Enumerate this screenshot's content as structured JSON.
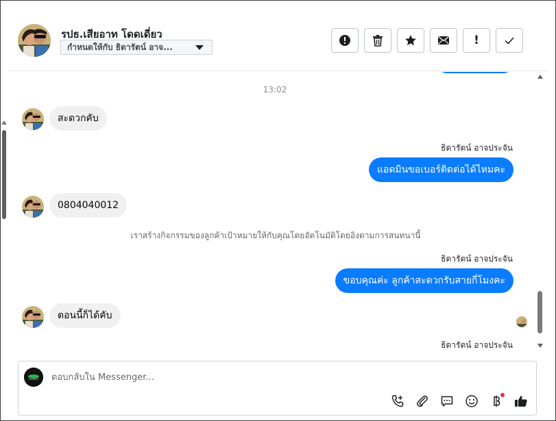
{
  "header": {
    "contact_name": "รปธ.เสียอาท โดดเดี่ยว",
    "assign_label": "กำหนดให้กับ ธิดารัตน์ อาจ...",
    "actions": [
      {
        "name": "spam-button",
        "icon": "alert-circle-icon"
      },
      {
        "name": "delete-button",
        "icon": "trash-icon"
      },
      {
        "name": "star-button",
        "icon": "star-icon"
      },
      {
        "name": "mark-unread-button",
        "icon": "envelope-icon"
      },
      {
        "name": "follow-up-button",
        "icon": "exclamation-icon"
      },
      {
        "name": "mark-done-button",
        "icon": "checkmark-icon"
      }
    ]
  },
  "conversation": {
    "timestamp": "13:02",
    "messages": [
      {
        "direction": "in",
        "text": "สะดวกคับ"
      },
      {
        "direction": "out",
        "sender": "ธิดารัตน์ อาจประจัน",
        "text": "แอดมินขอเบอร์ติดต่อได้ไหมคะ"
      },
      {
        "direction": "in",
        "text": "0804040012"
      },
      {
        "direction": "system",
        "text": "เราสร้างกิจกรรมของลูกค้าเป้าหมายให้กับคุณโดยอัตโนมัติโดยอิงตามการสนทนานี้"
      },
      {
        "direction": "out",
        "sender": "ธิดารัตน์ อาจประจัน",
        "text": "ขอบคุณค่ะ ลูกค้าสะดวกรับสายกี่โมงคะ"
      },
      {
        "direction": "in",
        "text": "ตอนนี้ก็ได้คับ"
      },
      {
        "direction": "out-pending",
        "sender": "ธิดารัตน์ อาจประจัน"
      }
    ]
  },
  "composer": {
    "placeholder": "ตอบกลับใน Messenger...",
    "tools": [
      "phone-add-icon",
      "paperclip-icon",
      "speech-bubble-icon",
      "smiley-icon",
      "baht-icon",
      "thumbs-up-icon"
    ]
  },
  "colors": {
    "outgoing_bubble": "#0a7cff",
    "incoming_bubble": "#f0f0f0",
    "thumbs_up": "#1c1e21",
    "notification_dot": "#f02849"
  }
}
